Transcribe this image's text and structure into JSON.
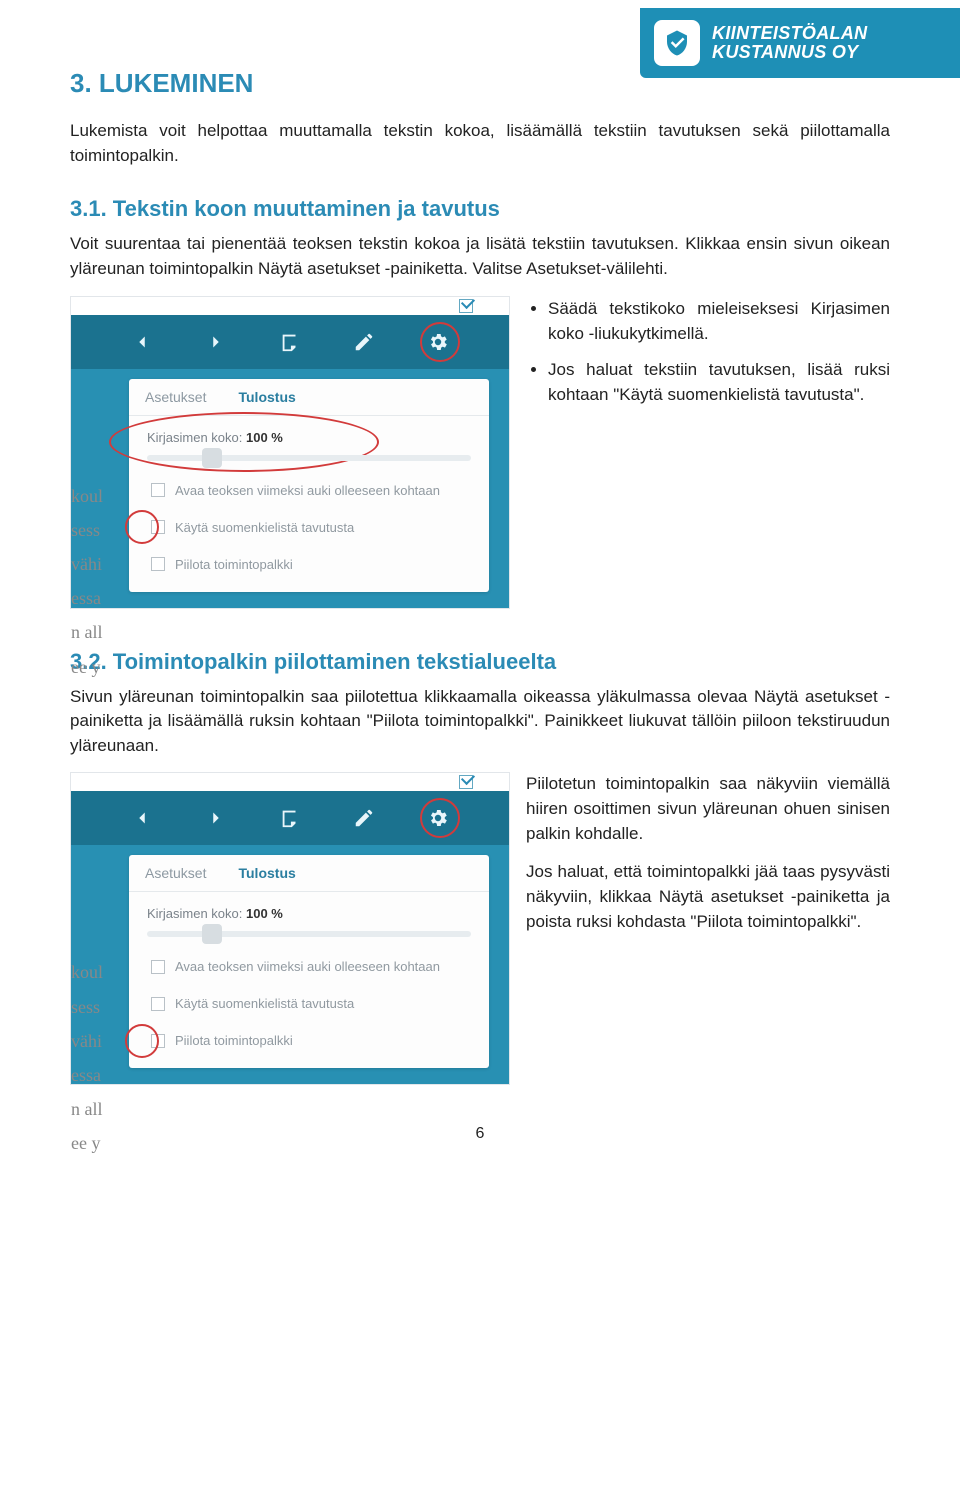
{
  "brand": {
    "line1": "KIINTEISTÖALAN",
    "line2": "KUSTANNUS OY"
  },
  "heading_main": "3. LUKEMINEN",
  "intro": "Lukemista voit helpottaa muuttamalla tekstin kokoa, lisäämällä tekstiin tavutuksen sekä piilottamalla toimintopalkin.",
  "section31": {
    "title": "3.1. Tekstin koon muuttaminen ja tavutus",
    "p1": "Voit suurentaa tai pienentää teoksen tekstin kokoa ja lisätä tekstiin tavutuksen. Klikkaa ensin sivun oikean yläreunan toimintopalkin Näytä asetukset -painiketta. Valitse Asetukset-välilehti.",
    "bullets": [
      "Säädä tekstikoko mieleiseksesi Kirjasimen koko -liukukytkimellä.",
      "Jos haluat tekstiin tavutuksen, lisää ruksi kohtaan \"Käytä suomenkielistä tavutusta\"."
    ]
  },
  "section32": {
    "title": "3.2. Toimintopalkin piilottaminen tekstialueelta",
    "p1": "Sivun yläreunan toimintopalkin saa piilotettua klikkaamalla oikeassa yläkulmassa olevaa Näytä asetukset -painiketta ja lisäämällä ruksin kohtaan \"Piilota toimintopalkki\". Painikkeet liukuvat tällöin piiloon tekstiruudun yläreunaan.",
    "p2": "Piilotetun toimintopalkin saa näkyviin viemällä hiiren osoittimen sivun yläreunan ohuen sinisen palkin kohdalle.",
    "p3": "Jos haluat, että toimintopalkki jää taas pysyvästi näkyviin, klikkaa Näytä asetukset -painiketta ja poista ruksi kohdasta \"Piilota toimintopalkki\"."
  },
  "shot": {
    "tabs": {
      "active": "Asetukset",
      "inactive": "Tulostus"
    },
    "slider_label_prefix": "Kirjasimen koko: ",
    "slider_value": "100 %",
    "chk_open_last": "Avaa teoksen viimeksi auki olleeseen kohtaan",
    "chk_hyphen": "Käytä suomenkielistä tavutusta",
    "chk_hide": "Piilota toimintopalkki",
    "edge": [
      "koul",
      "sess",
      "vähi",
      "essa",
      "",
      "n all",
      "ee y"
    ]
  },
  "page_number": "6"
}
